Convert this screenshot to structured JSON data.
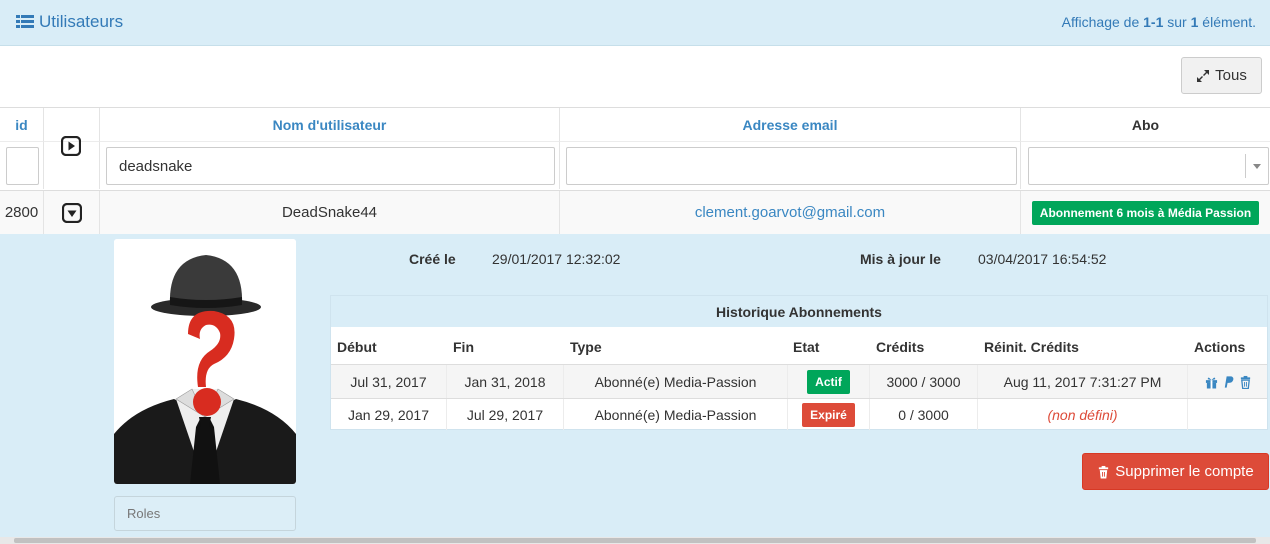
{
  "header": {
    "title": "Utilisateurs",
    "pager_prefix": "Affichage de ",
    "pager_range": "1-1",
    "pager_mid": " sur ",
    "pager_total": "1",
    "pager_suffix": " élément."
  },
  "toolbar": {
    "all_label": "Tous"
  },
  "columns": {
    "id": "id",
    "username": "Nom d'utilisateur",
    "email": "Adresse email",
    "abo": "Abo"
  },
  "filters": {
    "id": "",
    "username": "deadsnake",
    "email": "",
    "abo": ""
  },
  "row": {
    "id": "2800",
    "username": "DeadSnake44",
    "email": "clement.goarvot@gmail.com",
    "abo": "Abonnement 6 mois à Média Passion"
  },
  "detail": {
    "created_label": "Créé le",
    "created_value": "29/01/2017 12:32:02",
    "updated_label": "Mis à jour le",
    "updated_value": "03/04/2017 16:54:52",
    "roles_placeholder": "Roles",
    "delete_label": "Supprimer le compte"
  },
  "history": {
    "title": "Historique Abonnements",
    "headers": [
      "Début",
      "Fin",
      "Type",
      "Etat",
      "Crédits",
      "Réinit. Crédits",
      "Actions"
    ],
    "rows": [
      {
        "debut": "Jul 31, 2017",
        "fin": "Jan 31, 2018",
        "type": "Abonné(e) Media-Passion",
        "etat": "Actif",
        "credits": "3000 / 3000",
        "reinit": "Aug 11, 2017 7:31:27 PM"
      },
      {
        "debut": "Jan 29, 2017",
        "fin": "Jul 29, 2017",
        "type": "Abonné(e) Media-Passion",
        "etat": "Expiré",
        "credits": "0 / 3000",
        "reinit": "(non défini)"
      }
    ]
  },
  "colors": {
    "accent": "#337ab7",
    "success": "#00a65a",
    "danger": "#dd4b39",
    "panel": "#d9edf7"
  },
  "icons": [
    "list-icon",
    "expand-icon",
    "play-icon",
    "chevron-down-icon",
    "gift-icon",
    "paypal-icon",
    "trash-icon"
  ]
}
